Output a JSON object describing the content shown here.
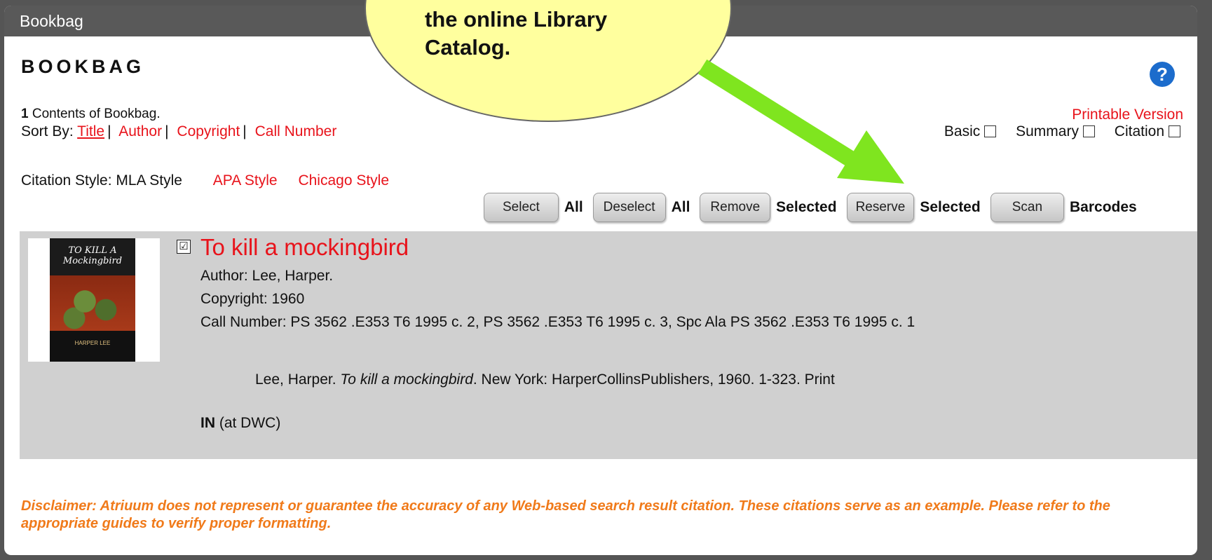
{
  "window": {
    "title": "Bookbag"
  },
  "page": {
    "heading": "BOOKBAG",
    "help_icon": "question-circle-icon",
    "contents_count": "1",
    "contents_suffix": " Contents of Bookbag.",
    "sort_label": "Sort By: ",
    "sort_options": [
      "Title",
      "Author",
      "Copyright",
      "Call Number"
    ],
    "printable_label": "Printable Version",
    "formats": [
      "Basic",
      "Summary",
      "Citation"
    ],
    "citation_label": "Citation Style: MLA Style",
    "citation_styles": [
      "APA Style",
      "Chicago Style"
    ]
  },
  "toolbar": {
    "select": "Select",
    "select_after": "All",
    "deselect": "Deselect",
    "deselect_after": "All",
    "remove": "Remove",
    "remove_after": "Selected",
    "reserve": "Reserve",
    "reserve_after": "Selected",
    "scan": "Scan",
    "scan_after": "Barcodes"
  },
  "result": {
    "checked_glyph": "☑",
    "cover_title": "TO KILL A Mockingbird",
    "cover_author": "HARPER LEE",
    "title": "To kill a mockingbird",
    "author": "Author: Lee, Harper.",
    "copyright": "Copyright: 1960",
    "call_number": "Call Number: PS 3562 .E353 T6 1995 c. 2, PS 3562 .E353 T6 1995 c. 3, Spc Ala PS 3562 .E353 T6 1995 c. 1",
    "citation_prefix": "Lee, Harper. ",
    "citation_title": "To kill a mockingbird",
    "citation_suffix": ". New York: HarperCollinsPublishers, 1960. 1-323. Print",
    "status_code": "IN",
    "status_location": " (at DWC)"
  },
  "disclaimer": "Disclaimer: Atriuum does not represent or guarantee the accuracy of any Web-based search result citation. These citations serve as an example. Please refer to the appropriate guides to verify proper formatting.",
  "callout": {
    "line1": "the online Library",
    "line2": "Catalog."
  },
  "colors": {
    "link": "#e8131b",
    "titlebar": "#595959",
    "result_bg": "#d0d0d0",
    "disclaimer": "#f07a1a",
    "callout": "#ffff9e",
    "arrow": "#7fe51f"
  }
}
